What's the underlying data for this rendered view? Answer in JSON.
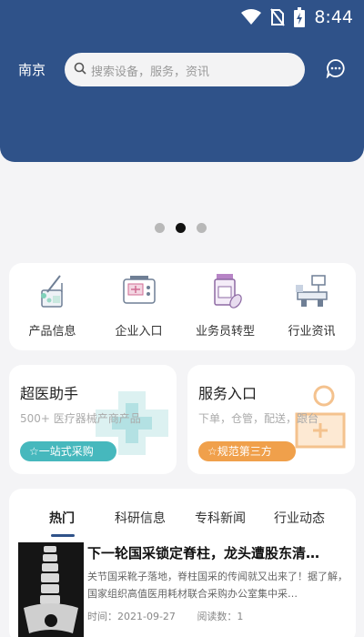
{
  "status_bar": {
    "time": "8:44",
    "icons": [
      "wifi-icon",
      "no-sim-icon",
      "battery-icon"
    ]
  },
  "header": {
    "city": "南京",
    "search_placeholder": "搜索设备，服务，资讯",
    "message_icon": "chat-bubble-icon"
  },
  "banner": {
    "page_count": 3,
    "active_page": 2
  },
  "quick_menu": [
    {
      "label": "产品信息",
      "icon": "product-kit-icon"
    },
    {
      "label": "企业入口",
      "icon": "enterprise-device-icon"
    },
    {
      "label": "业务员转型",
      "icon": "medicine-bottle-icon"
    },
    {
      "label": "行业资讯",
      "icon": "medical-equipment-icon"
    }
  ],
  "promos": {
    "left": {
      "title": "超医助手",
      "subtitle": "500+ 医疗器械产商产品",
      "badge": "☆一站式采购"
    },
    "right": {
      "title": "服务入口",
      "subtitle": "下单，仓管，配送，跟台",
      "badge": "☆规范第三方"
    }
  },
  "news": {
    "tabs": [
      "热门",
      "科研信息",
      "专科新闻",
      "行业动态"
    ],
    "active_tab": "热门",
    "items": [
      {
        "title": "下一轮国采锁定脊柱，龙头遭股东清…",
        "summary": "关节国采靴子落地，脊柱国采的传闻就又出来了！据了解，国家组织高值医用耗材联合采购办公室集中采…",
        "time": "时间：2021-09-27",
        "reads": "阅读数：1"
      }
    ]
  },
  "colors": {
    "primary": "#2f5289",
    "teal": "#46b8bd",
    "orange": "#f0a04b",
    "background": "#f4f4f6"
  }
}
